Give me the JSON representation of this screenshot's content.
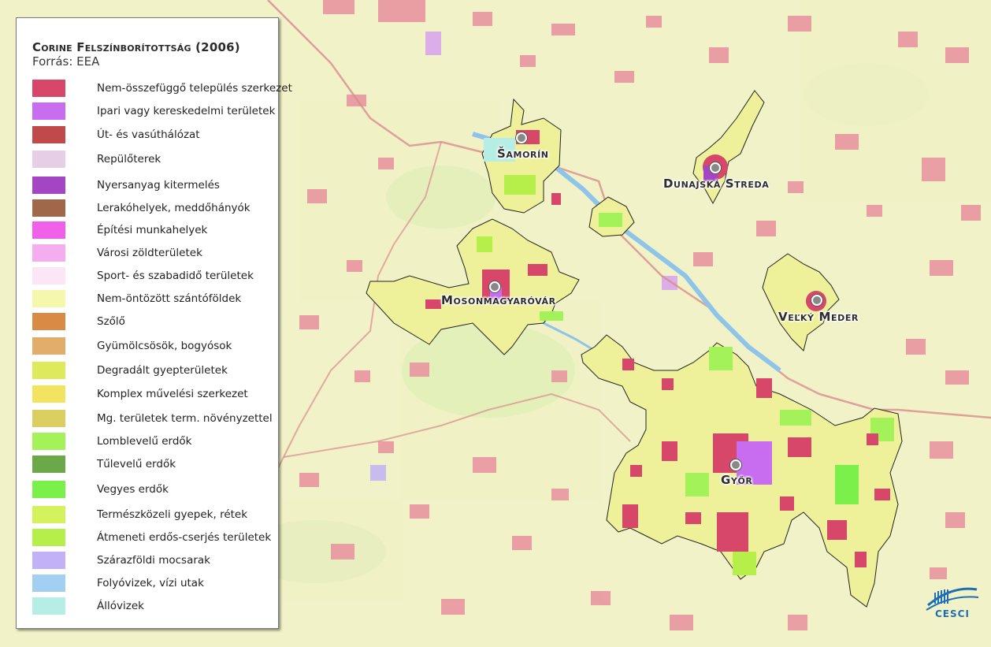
{
  "legend": {
    "title": "Corine Felszínborítottság (2006)",
    "source": "Forrás: EEA",
    "items": [
      {
        "label": "Nem-összefüggő település szerkezet",
        "color": "#d6476a"
      },
      {
        "label": "Ipari vagy kereskedelmi területek",
        "color": "#c86cf0"
      },
      {
        "label": "Út- és vasúthálózat",
        "color": "#c04a4a"
      },
      {
        "label": "Repülőterek",
        "color": "#e6cfe6"
      },
      {
        "label": "Nyersanyag kitermelés",
        "color": "#a445c4"
      },
      {
        "label": "Lerakóhelyek, meddőhányók",
        "color": "#a0674a"
      },
      {
        "label": "Építési munkahelyek",
        "color": "#f060e8"
      },
      {
        "label": "Városi zöldterületek",
        "color": "#f4aef0"
      },
      {
        "label": "Sport- és szabadidő területek",
        "color": "#fbe6f6"
      },
      {
        "label": "Nem-öntözött szántóföldek",
        "color": "#f5f7ad"
      },
      {
        "label": "Szőlő",
        "color": "#d98b45"
      },
      {
        "label": "Gyümölcsösök, bogyósok",
        "color": "#e0ad6a"
      },
      {
        "label": "Degradált gyepterületek",
        "color": "#dfe95c"
      },
      {
        "label": "Komplex művelési szerkezet",
        "color": "#f2e460"
      },
      {
        "label": "Mg. területek term. növényzettel",
        "color": "#dccf62"
      },
      {
        "label": "Lomblevelű erdők",
        "color": "#a4f25a"
      },
      {
        "label": "Tűlevelű erdők",
        "color": "#6aa84a"
      },
      {
        "label": "Vegyes erdők",
        "color": "#7cf04a"
      },
      {
        "label": "Természközeli gyepek, rétek",
        "color": "#d4f25c"
      },
      {
        "label": "Átmeneti erdős-cserjés területek",
        "color": "#b6ee4a"
      },
      {
        "label": "Szárazföldi mocsarak",
        "color": "#c2b2f5"
      },
      {
        "label": "Folyóvizek, vízi utak",
        "color": "#a3d0f2"
      },
      {
        "label": "Állóvizek",
        "color": "#b6eee6"
      }
    ]
  },
  "cities": [
    {
      "name": "Šamorín"
    },
    {
      "name": "Dunajská Streda"
    },
    {
      "name": "Mosonmagyaróvár"
    },
    {
      "name": "Veľký Meder"
    },
    {
      "name": "Győr"
    }
  ],
  "logo": {
    "text": "CESCI"
  },
  "colors": {
    "background": "#f1f2c8",
    "region_fill": "#eef09a",
    "settlement": "#d6476a",
    "river": "#8fc4ea",
    "border": "#d98b8b"
  }
}
